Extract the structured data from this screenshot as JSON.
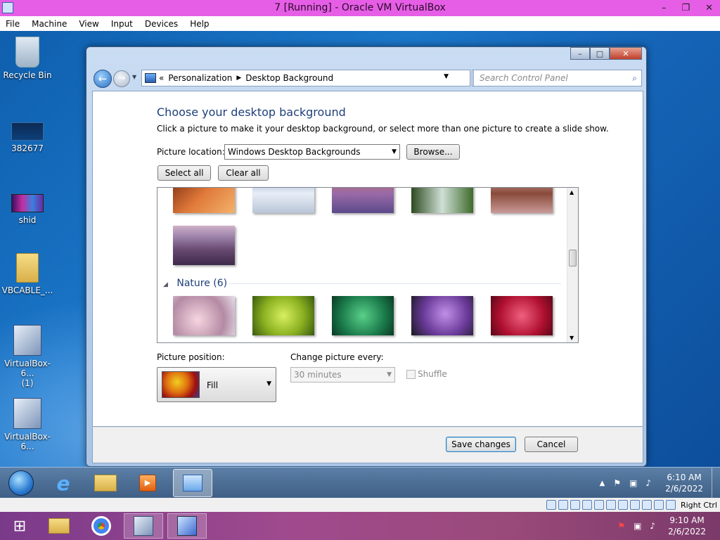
{
  "host": {
    "title": "7 [Running] - Oracle VM VirtualBox",
    "menu": [
      "File",
      "Machine",
      "View",
      "Input",
      "Devices",
      "Help"
    ],
    "status_right": "Right Ctrl",
    "clock_time": "9:10 AM",
    "clock_date": "2/6/2022"
  },
  "desktop": {
    "icons": [
      {
        "label": "Recycle Bin"
      },
      {
        "label": "382677"
      },
      {
        "label": "shid"
      },
      {
        "label": "VBCABLE_..."
      },
      {
        "label": "VirtualBox-6...\n(1)"
      },
      {
        "label": "VirtualBox-6..."
      }
    ]
  },
  "window": {
    "breadcrumb_root": "Personalization",
    "breadcrumb_current": "Desktop Background",
    "search_placeholder": "Search Control Panel",
    "heading": "Choose your desktop background",
    "instruction": "Click a picture to make it your desktop background, or select more than one picture to create a slide show.",
    "picture_location_label": "Picture location:",
    "picture_location_value": "Windows Desktop Backgrounds",
    "browse_label": "Browse...",
    "select_all_label": "Select all",
    "clear_all_label": "Clear all",
    "section_nature": "Nature (6)",
    "picture_position_label": "Picture position:",
    "picture_position_value": "Fill",
    "change_every_label": "Change picture every:",
    "change_every_value": "30 minutes",
    "shuffle_label": "Shuffle",
    "save_label": "Save changes",
    "cancel_label": "Cancel"
  },
  "guest_clock": {
    "time": "6:10 AM",
    "date": "2/6/2022"
  }
}
